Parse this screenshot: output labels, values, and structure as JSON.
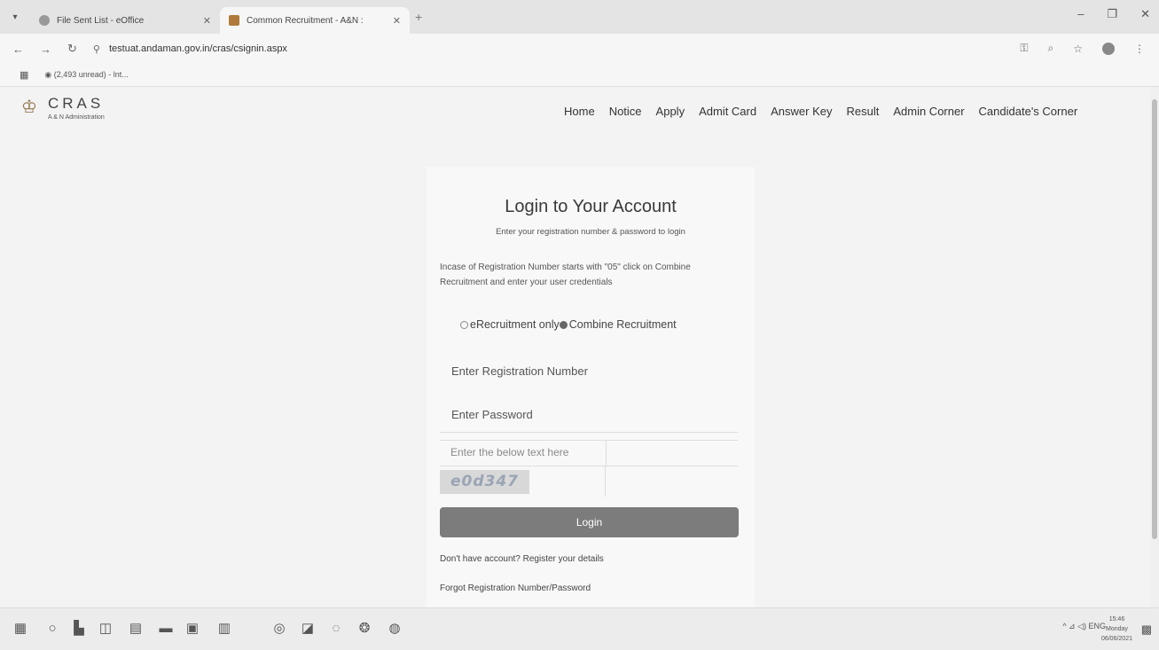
{
  "browser": {
    "tabs": [
      {
        "title": "File Sent List - eOffice",
        "active": false
      },
      {
        "title": "Common Recruitment - A&N :",
        "active": true
      }
    ],
    "url": "testuat.andaman.gov.in/cras/csignin.aspx",
    "bookmark": "(2,493 unread) - lnt..."
  },
  "site": {
    "brand": "CRAS",
    "brand_sub": "A & N Administration",
    "nav": [
      "Home",
      "Notice",
      "Apply",
      "Admit Card",
      "Answer Key",
      "Result",
      "Admin Corner",
      "Candidate's Corner"
    ]
  },
  "login": {
    "title": "Login to Your Account",
    "subtitle": "Enter your registration number & password to login",
    "notice": "Incase of Registration Number starts with \"05\" click on Combine Recruitment and enter your user credentials",
    "radio_option1": "eRecruitment only",
    "radio_option2": "Combine Recruitment",
    "registration_placeholder": "Enter Registration Number",
    "password_placeholder": "Enter Password",
    "captcha_placeholder": "Enter the below text here",
    "captcha_text": "e0d347",
    "button": "Login",
    "register_link": "Don't have account? Register your details",
    "forgot_link": "Forgot Registration Number/Password"
  },
  "taskbar": {
    "tray": "^ ⊿ ◁) ENG",
    "time": "15:46",
    "day": "Monday",
    "date": "06/06/2021"
  },
  "colors": {
    "button": "#7c7c7c",
    "page_bg": "#f3f3f3"
  }
}
